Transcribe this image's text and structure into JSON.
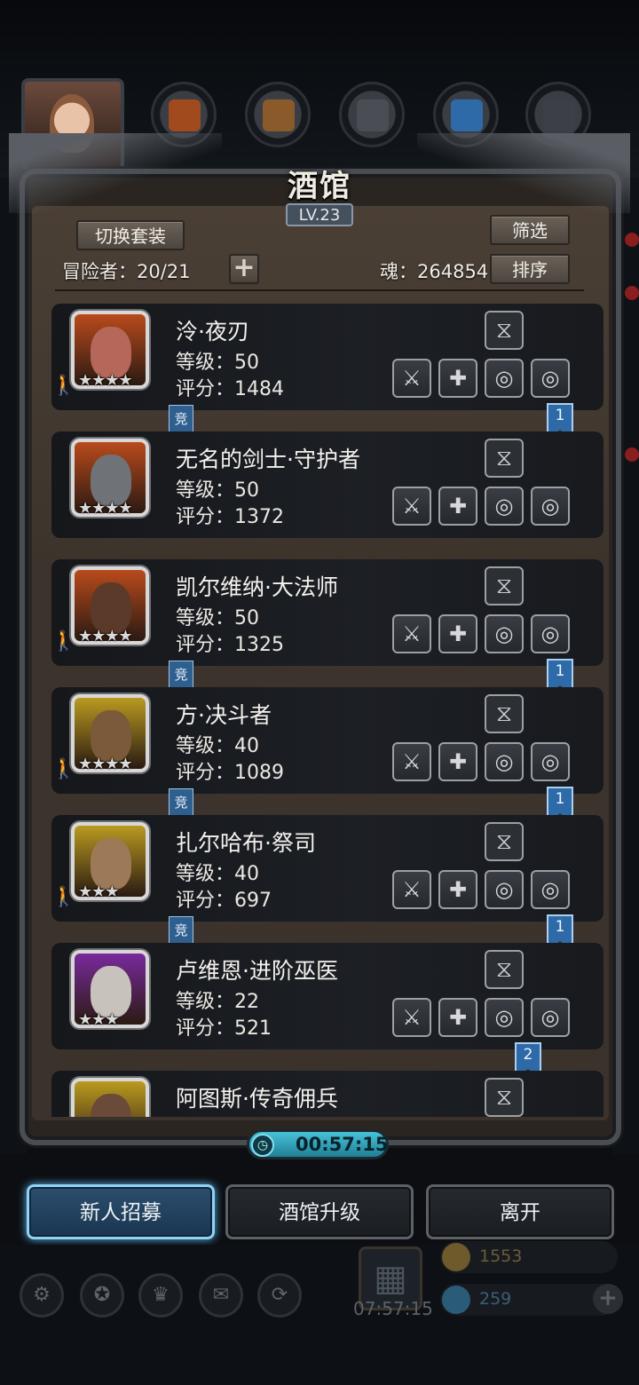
{
  "header": {
    "title": "酒馆",
    "level": "LV.23",
    "switch_outfit": "切换套装",
    "filter": "筛选",
    "sort": "排序",
    "adventurers": "冒险者：20/21",
    "soul": "魂：264854",
    "add_symbol": "+"
  },
  "heroes": [
    {
      "name": "泠·夜刃",
      "level": "等级：50",
      "score": "评分：1484",
      "stars": "★★★★",
      "badge": "竞",
      "rank": "1",
      "frame": "#b94a1c",
      "face": "#b5675a",
      "walker": true
    },
    {
      "name": "无名的剑士·守护者",
      "level": "等级：50",
      "score": "评分：1372",
      "stars": "★★★★",
      "badge": "",
      "rank": "",
      "frame": "#b94a1c",
      "face": "#6f7378",
      "walker": false
    },
    {
      "name": "凯尔维纳·大法师",
      "level": "等级：50",
      "score": "评分：1325",
      "stars": "★★★★",
      "badge": "竞",
      "rank": "1",
      "frame": "#b94a1c",
      "face": "#5b3a2a",
      "walker": true
    },
    {
      "name": "方·决斗者",
      "level": "等级：40",
      "score": "评分：1089",
      "stars": "★★★★",
      "badge": "竞",
      "rank": "1",
      "frame": "#b99a20",
      "face": "#7a5a3a",
      "walker": true
    },
    {
      "name": "扎尔哈布·祭司",
      "level": "等级：40",
      "score": "评分：697",
      "stars": "★★★",
      "badge": "竞",
      "rank": "1",
      "frame": "#b99a20",
      "face": "#9c7a58",
      "walker": true
    },
    {
      "name": "卢维恩·进阶巫医",
      "level": "等级：22",
      "score": "评分：521",
      "stars": "★★★",
      "badge": "",
      "rank": "2",
      "frame": "#7a2a9c",
      "face": "#c8c2bc",
      "walker": false
    },
    {
      "name": "阿图斯·传奇佣兵",
      "level": "",
      "score": "",
      "stars": "",
      "badge": "",
      "rank": "",
      "frame": "#b99a20",
      "face": "#6a4a38",
      "walker": false
    }
  ],
  "timer": "00:57:15",
  "buttons": {
    "recruit": "新人招募",
    "upgrade": "酒馆升级",
    "leave": "离开"
  },
  "bottom": {
    "time": "07:57:15",
    "gold": "1553",
    "gems": "259"
  },
  "colors": {
    "accent_blue": "#8fd2f6",
    "panel_brown": "#3c342c",
    "row_dark": "#1c1f24"
  }
}
